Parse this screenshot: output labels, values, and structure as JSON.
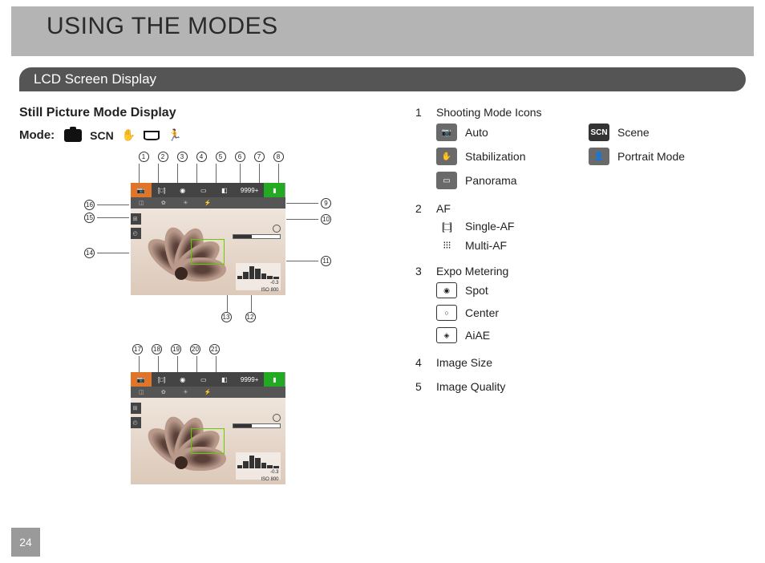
{
  "page_number": "24",
  "title": "USING THE MODES",
  "section": "LCD Screen Display",
  "subheading": "Still Picture Mode Display",
  "mode_label": "Mode:",
  "mode_list": {
    "scn": "SCN"
  },
  "diagram1_callouts_top": [
    "1",
    "2",
    "3",
    "4",
    "5",
    "6",
    "7",
    "8"
  ],
  "diagram1_callouts_right": [
    "9",
    "10",
    "11"
  ],
  "diagram1_callouts_left": [
    "16",
    "15",
    "14"
  ],
  "diagram1_callouts_bottom": [
    "13",
    "12"
  ],
  "diagram2_callouts_top": [
    "17",
    "18",
    "19",
    "20",
    "21"
  ],
  "lcd": {
    "shots_remaining": "9999+",
    "ev": "-0.3",
    "iso": "ISO 800"
  },
  "legend": [
    {
      "num": "1",
      "hdr": "Shooting Mode Icons",
      "icons": [
        {
          "name": "auto-icon",
          "glyph": "📷",
          "label": "Auto"
        },
        {
          "name": "scene-icon",
          "glyph": "SCN",
          "label": "Scene",
          "dark": true
        },
        {
          "name": "stabilization-icon",
          "glyph": "✋",
          "label": "Stabilization"
        },
        {
          "name": "portrait-mode-icon",
          "glyph": "👤",
          "label": "Portrait Mode"
        },
        {
          "name": "panorama-icon",
          "glyph": "▭",
          "label": "Panorama"
        }
      ]
    },
    {
      "num": "2",
      "hdr": "AF",
      "af": [
        {
          "name": "single-af-icon",
          "glyph": "[□]",
          "label": "Single-AF"
        },
        {
          "name": "multi-af-icon",
          "glyph": "⁞⁞",
          "label": "Multi-AF"
        }
      ]
    },
    {
      "num": "3",
      "hdr": "Expo Metering",
      "meter": [
        {
          "name": "spot-metering-icon",
          "glyph": "◉",
          "label": "Spot"
        },
        {
          "name": "center-metering-icon",
          "glyph": "○",
          "label": "Center"
        },
        {
          "name": "aiae-metering-icon",
          "glyph": "◈",
          "label": "AiAE"
        }
      ]
    },
    {
      "num": "4",
      "hdr": "Image Size"
    },
    {
      "num": "5",
      "hdr": "Image Quality"
    }
  ]
}
